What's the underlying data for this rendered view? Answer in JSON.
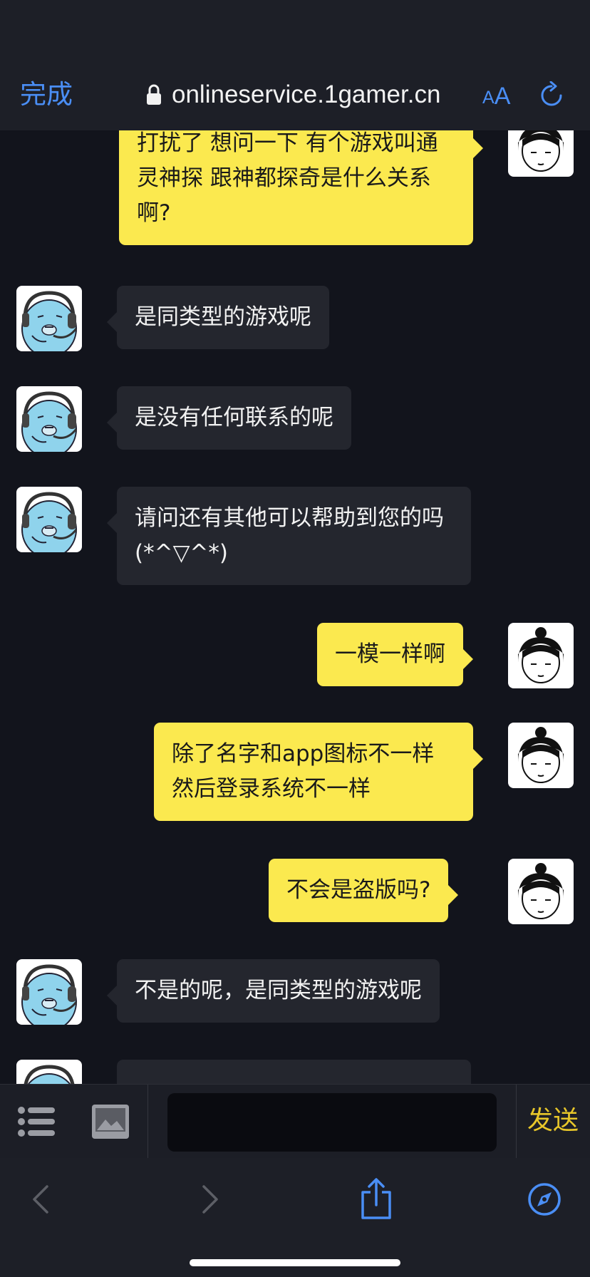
{
  "browser": {
    "done_label": "完成",
    "url": "onlineservice.1gamer.cn",
    "text_size_small": "A",
    "text_size_large": "A"
  },
  "messages": [
    {
      "sender": "user",
      "text": "打扰了 想问一下 有个游戏叫通灵神探 跟神都探奇是什么关系啊?"
    },
    {
      "sender": "agent",
      "text": "是同类型的游戏呢"
    },
    {
      "sender": "agent",
      "text": "是没有任何联系的呢"
    },
    {
      "sender": "agent",
      "text": "请问还有其他可以帮助到您的吗(*^▽^*)"
    },
    {
      "sender": "user",
      "text": "一模一样啊"
    },
    {
      "sender": "user",
      "text": "除了名字和app图标不一样然后登录系统不一样"
    },
    {
      "sender": "user",
      "text": "不会是盗版吗?"
    },
    {
      "sender": "agent",
      "text": "不是的呢，是同类型的游戏呢"
    },
    {
      "sender": "agent",
      "text": ""
    }
  ],
  "input": {
    "value": "",
    "send_label": "发送"
  },
  "icons": {
    "lock": "lock-icon",
    "text_size": "text-size-icon",
    "reload": "reload-icon",
    "list": "list-icon",
    "image": "image-icon",
    "back": "back-icon",
    "forward": "forward-icon",
    "share": "share-icon",
    "compass": "compass-icon"
  },
  "colors": {
    "accent": "#4a8ef5",
    "user_bubble": "#fbe94f",
    "agent_bubble": "#24262e",
    "send": "#e7c62a"
  }
}
